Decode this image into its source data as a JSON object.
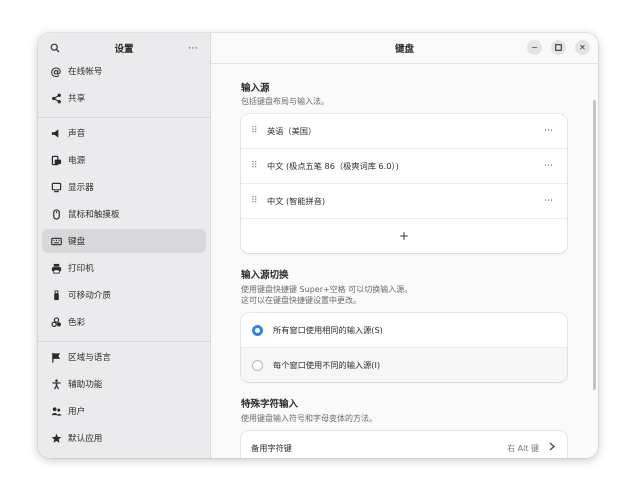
{
  "sidebar": {
    "title": "设置",
    "items": [
      {
        "label": "在线帐号",
        "icon": "at-icon"
      },
      {
        "label": "共享",
        "icon": "share-icon"
      },
      {
        "label": "声音",
        "icon": "speaker-icon"
      },
      {
        "label": "电源",
        "icon": "power-icon"
      },
      {
        "label": "显示器",
        "icon": "display-icon"
      },
      {
        "label": "鼠标和触摸板",
        "icon": "mouse-icon"
      },
      {
        "label": "键盘",
        "icon": "keyboard-icon",
        "selected": true
      },
      {
        "label": "打印机",
        "icon": "printer-icon"
      },
      {
        "label": "可移动介质",
        "icon": "usb-icon"
      },
      {
        "label": "色彩",
        "icon": "palette-icon"
      },
      {
        "label": "区域与语言",
        "icon": "flag-icon"
      },
      {
        "label": "辅助功能",
        "icon": "accessibility-icon"
      },
      {
        "label": "用户",
        "icon": "users-icon"
      },
      {
        "label": "默认应用",
        "icon": "star-icon"
      }
    ]
  },
  "main": {
    "title": "键盘",
    "input_sources": {
      "title": "输入源",
      "desc": "包括键盘布局与输入法。",
      "items": [
        "英语（美国）",
        "中文 (极点五笔 86（极爽词库 6.0）)",
        "中文 (智能拼音)"
      ],
      "add_label": "+"
    },
    "switching": {
      "title": "输入源切换",
      "desc_line1": "使用键盘快捷键 Super+空格 可以切换输入源。",
      "desc_line2": "这可以在键盘快捷键设置中更改。",
      "option_same": "所有窗口使用相同的输入源(S)",
      "option_diff": "每个窗口使用不同的输入源(I)",
      "selected": "same"
    },
    "special_chars": {
      "title": "特殊字符输入",
      "desc": "使用键盘输入符号和字母变体的方法。",
      "alt_key_label": "备用字符键",
      "alt_key_value": "右 Alt 键"
    }
  },
  "colors": {
    "accent": "#3584e4",
    "sidebar_bg": "#ebebed",
    "selected_bg": "#d8d8da"
  }
}
